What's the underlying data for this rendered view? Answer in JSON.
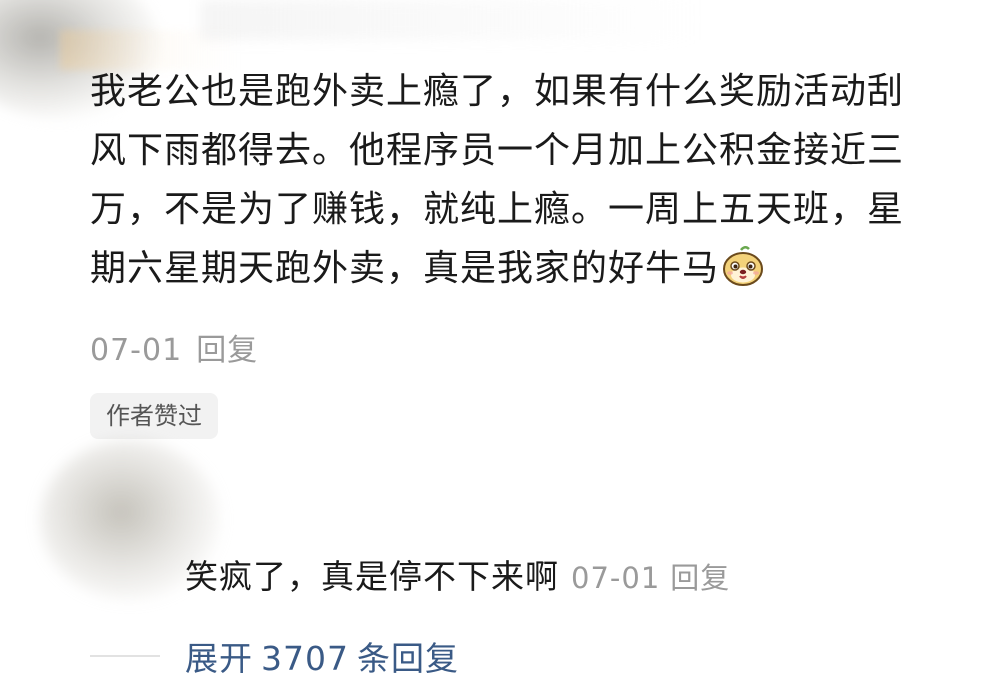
{
  "comment": {
    "lines": [
      "我老公也是跑外卖上瘾了，如果有什么奖励活动刮",
      "风下雨都得去。他程序员一个月加上公积金接近三",
      "万，不是为了赚钱，就纯上瘾。一周上五天班，星",
      "期六星期天跑外卖，真是我家的好牛马"
    ],
    "emoji": "dog-face-emoji",
    "date": "07-01",
    "reply_label": "回复",
    "author_badge": "作者赞过"
  },
  "sub_reply": {
    "text": "笑疯了，真是停不下来啊",
    "date": "07-01",
    "reply_label": "回复"
  },
  "expand": {
    "prefix": "展开",
    "count": "3707",
    "suffix": "条回复"
  },
  "colors": {
    "text": "#1a1a1a",
    "meta": "#9a9a9a",
    "link": "#3a5a86",
    "badge_bg": "#f2f2f2"
  }
}
